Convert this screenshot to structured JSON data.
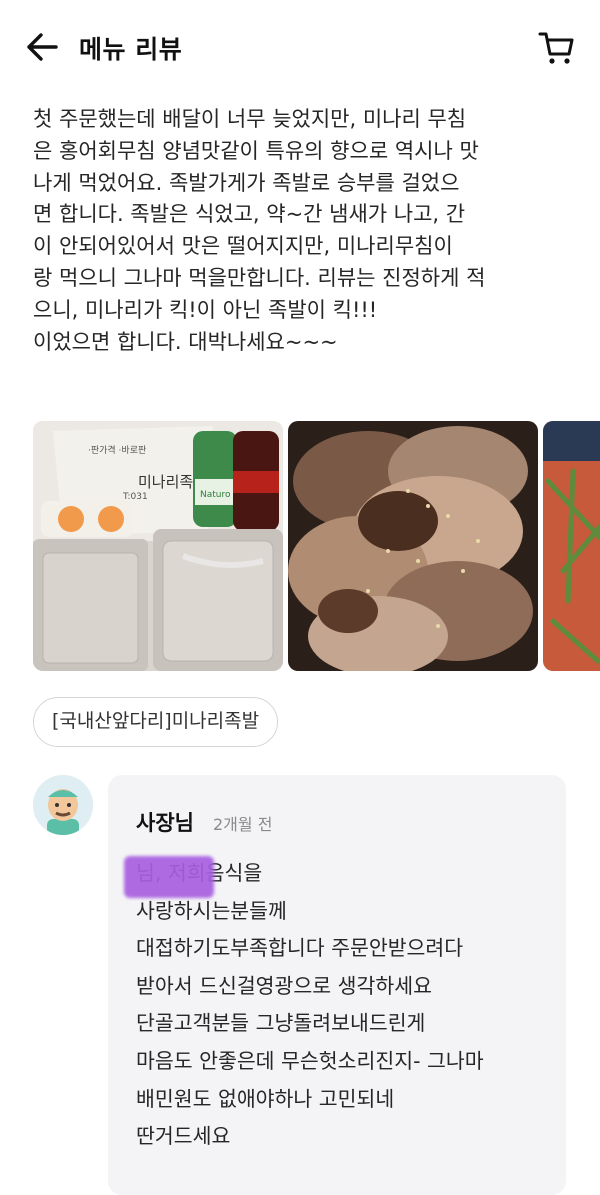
{
  "header": {
    "title": "메뉴 리뷰",
    "back_icon": "arrow-left-icon",
    "cart_icon": "cart-icon"
  },
  "review": {
    "text": "첫 주문했는데 배달이 너무 늦었지만, 미나리 무침\n은 홍어회무침 양념맛같이 특유의 향으로 역시나 맛\n나게 먹었어요. 족발가게가 족발로 승부를 걸었으\n면 합니다. 족발은 식었고, 약~간 냄새가 나고, 간\n이 안되어있어서 맛은 떨어지지만, 미나리무침이\n랑 먹으니 그나마 먹을만합니다. 리뷰는 진정하게 적\n으니, 미나리가 킥!이 아닌 족발이 킥!!!\n이었으면 합니다. 대박나세요~~~",
    "photos": [
      {
        "name": "delivery-package-photo",
        "label_lines": [
          "·판가격 ·바로판",
          "미나리족발",
          "T:031"
        ],
        "bottle_label": "Naturo"
      },
      {
        "name": "jokbal-photo"
      },
      {
        "name": "minari-salad-photo"
      }
    ],
    "menu_chip": "[국내산앞다리]미나리족발"
  },
  "reply": {
    "author": "사장님",
    "time": "2개월 전",
    "text": "      님, 저희음식을\n사랑하시는분들께\n대접하기도부족합니다 주문안받으려다\n받아서 드신걸영광으로 생각하세요\n단골고객분들 그냥돌려보내드린게\n마음도 안좋은데 무슨헛소리진지- 그나마\n배민원도 없애야하나 고민되네\n딴거드세요",
    "redaction_color": "#a85fe0"
  }
}
